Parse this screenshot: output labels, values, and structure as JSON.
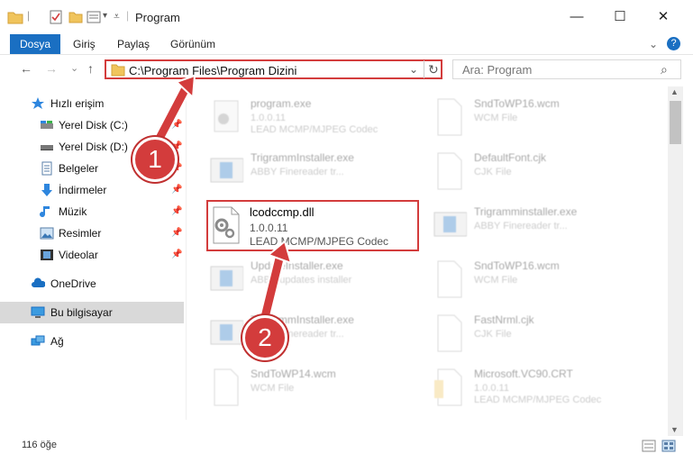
{
  "window": {
    "title": "Program",
    "minimize": "—",
    "maximize": "☐",
    "close": "✕"
  },
  "ribbon": {
    "tabs": [
      "Dosya",
      "Giriş",
      "Paylaş",
      "Görünüm"
    ],
    "collapse": "⌄",
    "help": "?"
  },
  "nav": {
    "back": "←",
    "forward": "→",
    "recent": "⌄",
    "up": "↑",
    "address": "C:\\Program Files\\Program Dizini",
    "address_dropdown": "⌄",
    "refresh": "↻",
    "search_placeholder": "Ara: Program",
    "search_icon": "⌕"
  },
  "sidebar": {
    "quick_access": "Hızlı erişim",
    "items": [
      "Yerel Disk (C:)",
      "Yerel Disk (D:)",
      "Belgeler",
      "İndirmeler",
      "Müzik",
      "Resimler",
      "Videolar"
    ],
    "onedrive": "OneDrive",
    "this_pc": "Bu bilgisayar",
    "network": "Ağ"
  },
  "files": [
    {
      "name": "program.exe",
      "sub1": "1.0.0.11",
      "sub2": "LEAD MCMP/MJPEG Codec",
      "icon": "exe-gear-icon"
    },
    {
      "name": "SndToWP16.wcm",
      "sub1": "WCM File",
      "sub2": "",
      "icon": "document-icon"
    },
    {
      "name": "TrigrammInstaller.exe",
      "sub1": "ABBY Finereader tr...",
      "sub2": "",
      "icon": "installer-icon"
    },
    {
      "name": "DefaultFont.cjk",
      "sub1": "CJK File",
      "sub2": "",
      "icon": "document-icon"
    },
    {
      "name": "Trigramminstaller.exe",
      "sub1": "ABBY Finereader tr...",
      "sub2": "",
      "icon": "installer-icon"
    },
    {
      "name": "UpdateInstaller.exe",
      "sub1": "ABBY updates installer",
      "sub2": "",
      "icon": "installer-icon"
    },
    {
      "name": "SndToWP16.wcm",
      "sub1": "WCM File",
      "sub2": "",
      "icon": "document-icon"
    },
    {
      "name": "TrigrammInstaller.exe",
      "sub1": "ABBY Finereader tr...",
      "sub2": "",
      "icon": "installer-icon"
    },
    {
      "name": "FastNrml.cjk",
      "sub1": "CJK File",
      "sub2": "",
      "icon": "document-icon"
    },
    {
      "name": "SndToWP14.wcm",
      "sub1": "WCM File",
      "sub2": "",
      "icon": "document-icon"
    },
    {
      "name": "Microsoft.VC90.CRT",
      "sub1": "1.0.0.11",
      "sub2": "LEAD MCMP/MJPEG Codec",
      "icon": "folder-doc-icon"
    }
  ],
  "highlighted_file": {
    "name": "lcodccmp.dll",
    "version": "1.0.0.11",
    "description": "LEAD MCMP/MJPEG Codec"
  },
  "status": {
    "count": "116 öğe"
  },
  "callouts": [
    "1",
    "2"
  ],
  "colors": {
    "accent": "#1a6fc2",
    "highlight": "#d33c3c",
    "selected_nav": "#d9d9d9"
  }
}
